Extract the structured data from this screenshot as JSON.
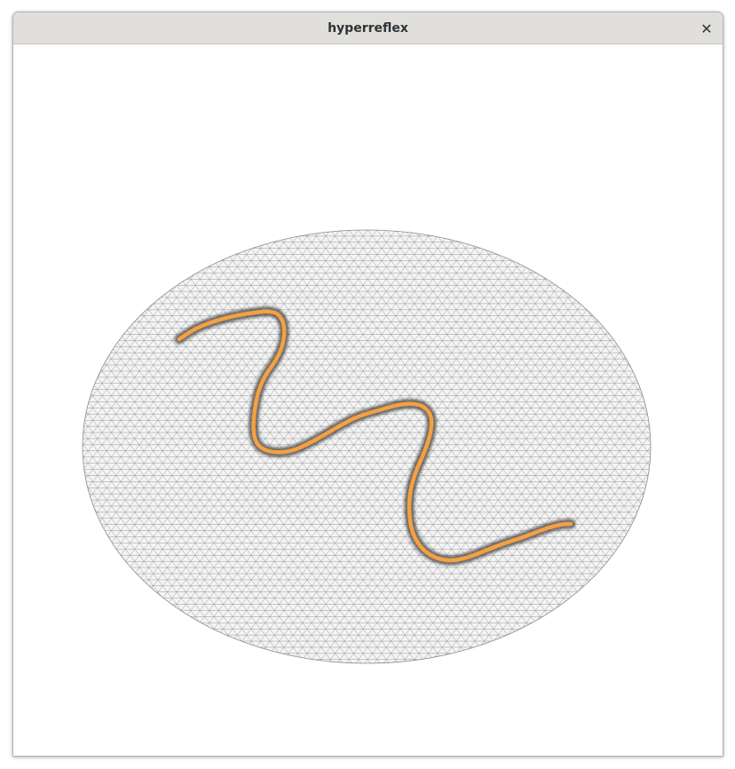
{
  "window": {
    "title": "hyperreflex",
    "close_glyph": "✕",
    "close_icon": "close-icon"
  },
  "viewport": {
    "background_color": "#ffffff",
    "mesh": {
      "shape": "triangulated-disc",
      "fill_color": "#f4f4f4",
      "edge_color": "#8c8c8c"
    },
    "curve": {
      "color": "#f5a041",
      "halo_color": "#3c3c3c"
    }
  }
}
